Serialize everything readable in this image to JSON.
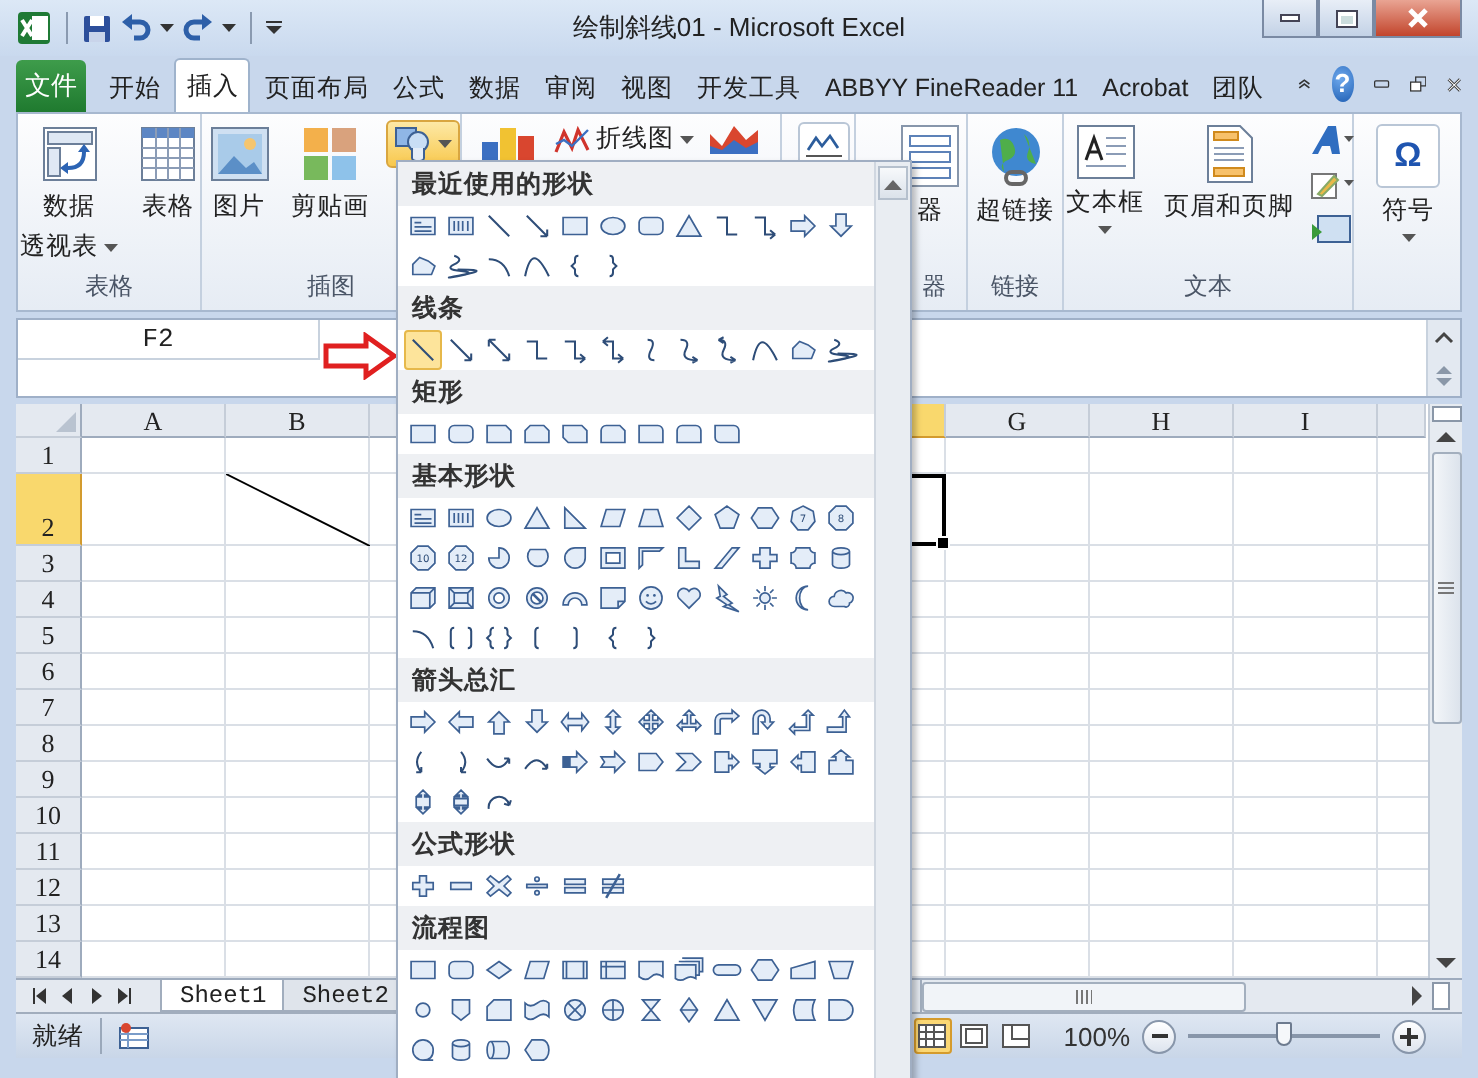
{
  "window": {
    "title": "绘制斜线01 - Microsoft Excel"
  },
  "ribbon_tabs": [
    {
      "label": "文件",
      "kind": "file",
      "selected": false
    },
    {
      "label": "开始",
      "kind": "tab",
      "selected": false
    },
    {
      "label": "插入",
      "kind": "tab",
      "selected": true
    },
    {
      "label": "页面布局",
      "kind": "tab",
      "selected": false
    },
    {
      "label": "公式",
      "kind": "tab",
      "selected": false
    },
    {
      "label": "数据",
      "kind": "tab",
      "selected": false
    },
    {
      "label": "审阅",
      "kind": "tab",
      "selected": false
    },
    {
      "label": "视图",
      "kind": "tab",
      "selected": false
    },
    {
      "label": "开发工具",
      "kind": "tab",
      "selected": false
    },
    {
      "label": "ABBYY FineReader 11",
      "kind": "tab",
      "selected": false
    },
    {
      "label": "Acrobat",
      "kind": "tab",
      "selected": false
    },
    {
      "label": "团队",
      "kind": "tab",
      "selected": false
    }
  ],
  "help_button": "?",
  "ribbon": {
    "table_group": {
      "label": "表格",
      "pivot_table": [
        "数据",
        "透视表"
      ],
      "table": "表格"
    },
    "illustrations_group": {
      "label": "插图",
      "picture": "图片",
      "clip_art": "剪贴画",
      "shapes_open": true
    },
    "charts_group": {
      "line_chart": "折线图"
    },
    "filter_group": {
      "label": "器",
      "slicer": "器"
    },
    "links_group": {
      "label": "链接",
      "hyperlink": "超链接"
    },
    "text_group": {
      "label": "文本",
      "text_box": "文本框",
      "header_footer": "页眉和页脚"
    },
    "symbols_group": {
      "symbol_glyph": "Ω",
      "symbol": "符号"
    }
  },
  "name_box": "F2",
  "shapes_gallery": {
    "sections": [
      {
        "title": "最近使用的形状"
      },
      {
        "title": "线条",
        "items": [
          {
            "selected": true
          },
          {
            "selected": false
          },
          {
            "selected": false
          },
          {
            "selected": false
          },
          {
            "selected": false
          },
          {
            "selected": false
          },
          {
            "selected": false
          },
          {
            "selected": false
          },
          {
            "selected": false
          },
          {
            "selected": false
          },
          {
            "selected": false
          },
          {
            "selected": false
          }
        ]
      },
      {
        "title": "矩形"
      },
      {
        "title": "基本形状",
        "numbered_labels": [
          "7",
          "8",
          "10",
          "12"
        ]
      },
      {
        "title": "箭头总汇"
      },
      {
        "title": "公式形状"
      },
      {
        "title": "流程图"
      }
    ]
  },
  "columns": [
    {
      "label": "A",
      "selected": false
    },
    {
      "label": "B",
      "selected": false
    },
    {
      "selected": true
    },
    {
      "label": "G",
      "selected": false
    },
    {
      "label": "H",
      "selected": false
    },
    {
      "label": "I",
      "selected": false
    }
  ],
  "rows": [
    {
      "label": "1",
      "selected": false
    },
    {
      "label": "2",
      "selected": true
    },
    {
      "label": "3",
      "selected": false
    },
    {
      "label": "4",
      "selected": false
    },
    {
      "label": "5",
      "selected": false
    },
    {
      "label": "6",
      "selected": false
    },
    {
      "label": "7",
      "selected": false
    },
    {
      "label": "8",
      "selected": false
    },
    {
      "label": "9",
      "selected": false
    },
    {
      "label": "10",
      "selected": false
    },
    {
      "label": "11",
      "selected": false
    },
    {
      "label": "12",
      "selected": false
    },
    {
      "label": "13",
      "selected": false
    },
    {
      "label": "14",
      "selected": false
    }
  ],
  "sheet_tabs": [
    {
      "label": "Sheet1",
      "selected": true
    },
    {
      "label": "Sheet2",
      "selected": false
    }
  ],
  "status_bar": {
    "status": "就绪",
    "views": [
      {
        "kind": "normal",
        "selected": true
      },
      {
        "kind": "page_layout",
        "selected": false
      },
      {
        "kind": "page_break",
        "selected": false
      }
    ],
    "zoom": "100%",
    "zoom_slider": {
      "level": 0.5
    }
  }
}
